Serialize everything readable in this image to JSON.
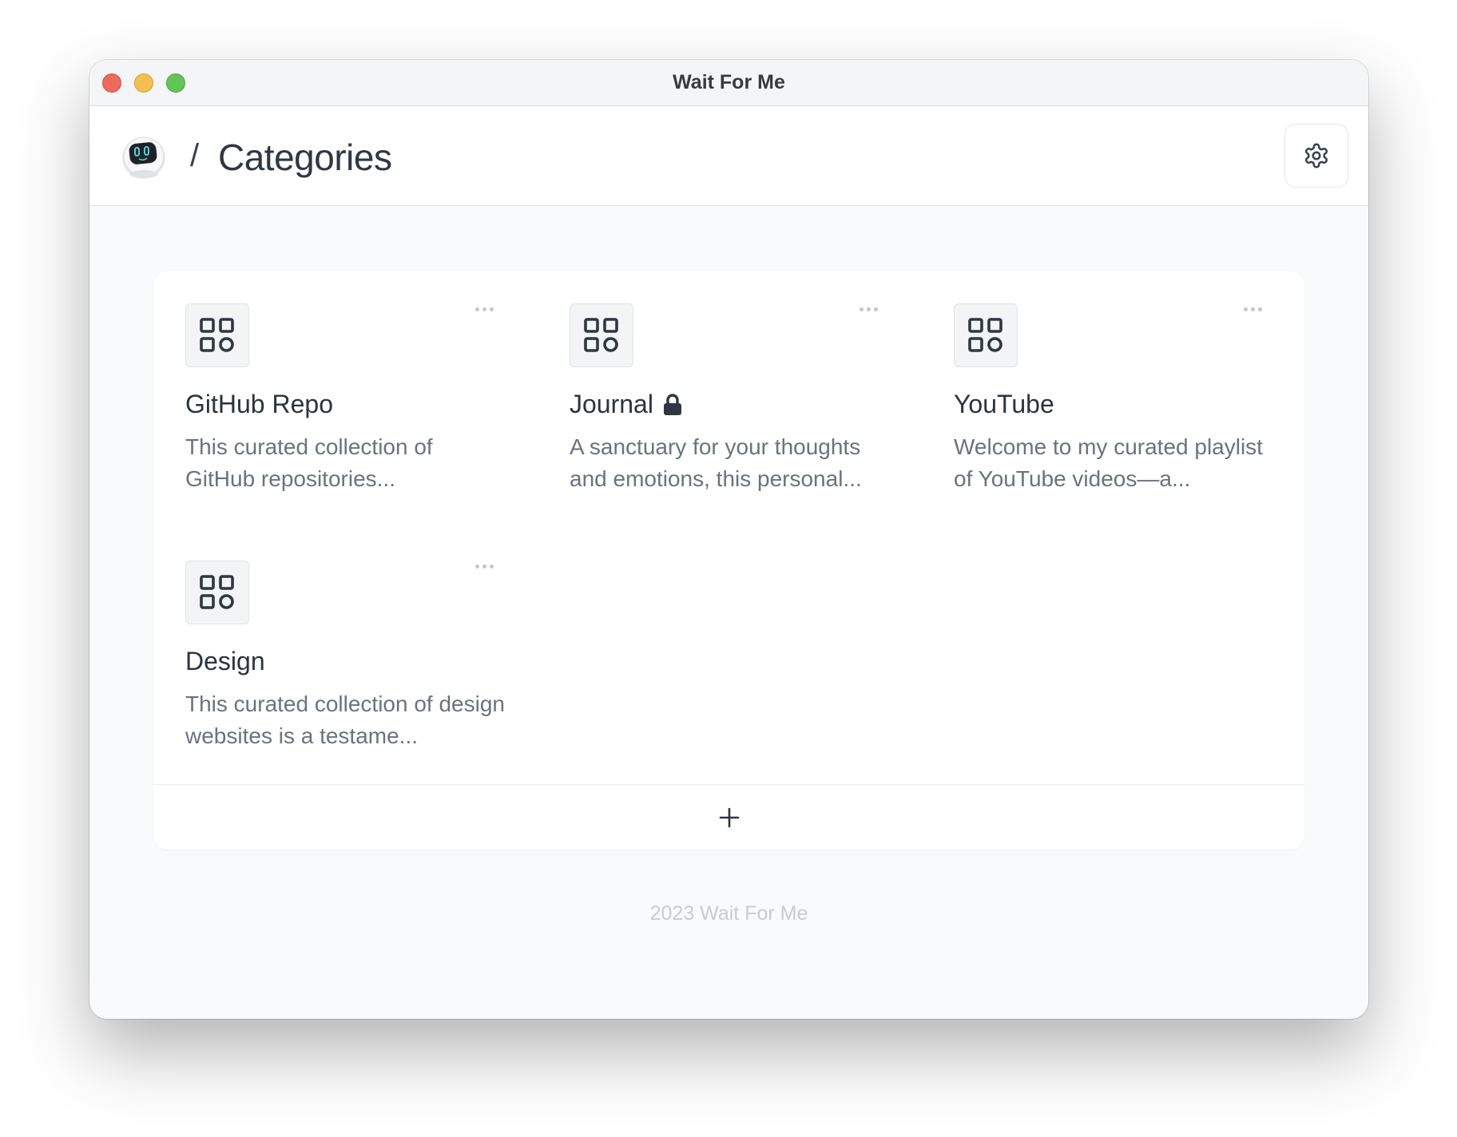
{
  "window": {
    "title": "Wait For Me"
  },
  "header": {
    "separator": "/",
    "title": "Categories"
  },
  "categories": [
    {
      "title": "GitHub Repo",
      "locked": false,
      "description": "This curated collection of GitHub repositories..."
    },
    {
      "title": "Journal",
      "locked": true,
      "description": "A sanctuary for your thoughts and emotions, this personal..."
    },
    {
      "title": "YouTube",
      "locked": false,
      "description": "Welcome to my curated playlist of YouTube videos—a..."
    },
    {
      "title": "Design",
      "locked": false,
      "description": "This curated collection of design websites is a testame..."
    }
  ],
  "add_label": "+",
  "footer": {
    "text": "2023 Wait For Me"
  },
  "colors": {
    "red": "#ed6a5e",
    "yellow": "#f5bf4f",
    "green": "#61c554",
    "text": "#2b3340",
    "muted": "#6b7280"
  },
  "icons": [
    "avatar-robot",
    "gear-icon",
    "grid-icon",
    "lock-icon",
    "more-icon",
    "plus-icon"
  ]
}
